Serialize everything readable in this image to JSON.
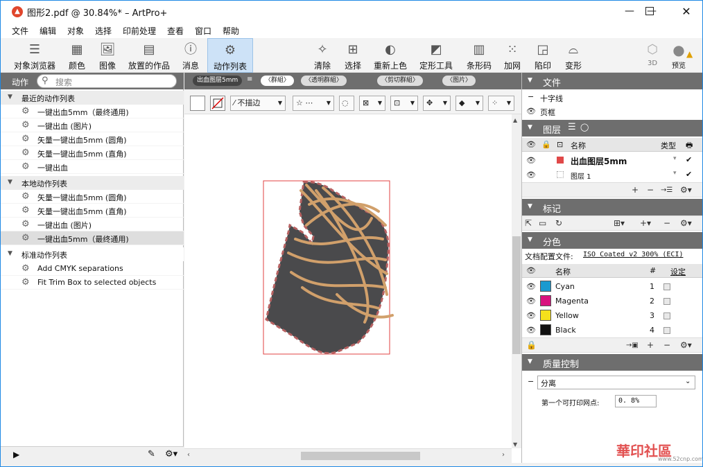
{
  "window": {
    "title": "图形2.pdf @ 30.84%* – ArtPro+"
  },
  "menu": [
    "文件",
    "编辑",
    "对象",
    "选择",
    "印前处理",
    "查看",
    "窗口",
    "帮助"
  ],
  "toolbar": [
    {
      "label": "对象浏览器",
      "icon": "list-icon"
    },
    {
      "label": "颜色",
      "icon": "grid-icon"
    },
    {
      "label": "图像",
      "icon": "image-icon"
    },
    {
      "label": "放置的作品",
      "icon": "document-icon"
    },
    {
      "label": "消息",
      "icon": "info-icon"
    },
    {
      "label": "动作列表",
      "icon": "gears-icon",
      "selected": true
    },
    {
      "label": "清除",
      "icon": "sparkle-icon"
    },
    {
      "label": "选择",
      "icon": "select-icon"
    },
    {
      "label": "重新上色",
      "icon": "palette-icon"
    },
    {
      "label": "定形工具",
      "icon": "shape-icon"
    },
    {
      "label": "条形码",
      "icon": "barcode-icon"
    },
    {
      "label": "加网",
      "icon": "screen-icon"
    },
    {
      "label": "陷印",
      "icon": "trap-icon"
    },
    {
      "label": "变形",
      "icon": "distort-icon"
    },
    {
      "label": "3D",
      "icon": "cube-icon"
    },
    {
      "label": "预览",
      "icon": "preview-icon"
    }
  ],
  "actions": {
    "header": "动作",
    "search_placeholder": "搜索",
    "groups": [
      {
        "name": "最近的动作列表",
        "items": [
          "一键出血5mm（最终通用)",
          "一键出血 (图片)",
          "矢量一键出血5mm (圆角)",
          "矢量一键出血5mm (直角)",
          "一键出血"
        ]
      },
      {
        "name": "本地动作列表",
        "items": [
          "矢量一键出血5mm (圆角)",
          "矢量一键出血5mm (直角)",
          "一键出血 (图片)",
          "一键出血5mm（最终通用)"
        ]
      },
      {
        "name": "标准动作列表",
        "items": [
          "Add CMYK separations",
          "Fit Trim Box to selected objects"
        ]
      }
    ]
  },
  "breadcrumb": [
    "出血图层5mm",
    "〈群組〉",
    "〈透明群組〉",
    "〈剪切群組〉",
    "〈图片〉"
  ],
  "controls": {
    "stroke": "不描边"
  },
  "panels": {
    "file": {
      "title": "文件",
      "items": [
        "十字线",
        "页框"
      ]
    },
    "layers": {
      "title": "图层",
      "col_name": "名称",
      "col_type": "类型",
      "rows": [
        {
          "name": "出血图层5mm"
        },
        {
          "name": "图层 1"
        }
      ]
    },
    "marks": {
      "title": "标记"
    },
    "separations": {
      "title": "分色",
      "profile_label": "文档配置文件:",
      "profile": "ISO Coated v2 300% (ECI)",
      "col_name": "名称",
      "col_num": "#",
      "col_set": "设定",
      "inks": [
        {
          "name": "Cyan",
          "num": "1",
          "color": "#1a9ad0"
        },
        {
          "name": "Magenta",
          "num": "2",
          "color": "#d8117e"
        },
        {
          "name": "Yellow",
          "num": "3",
          "color": "#f5e11c"
        },
        {
          "name": "Black",
          "num": "4",
          "color": "#111111"
        }
      ]
    },
    "qc": {
      "title": "质量控制",
      "select": "分离",
      "field_label": "第一个可打印网点:",
      "field_value": "0. 8%"
    }
  },
  "watermark": {
    "text": "華印社區",
    "url": "www.52cnp.com"
  }
}
